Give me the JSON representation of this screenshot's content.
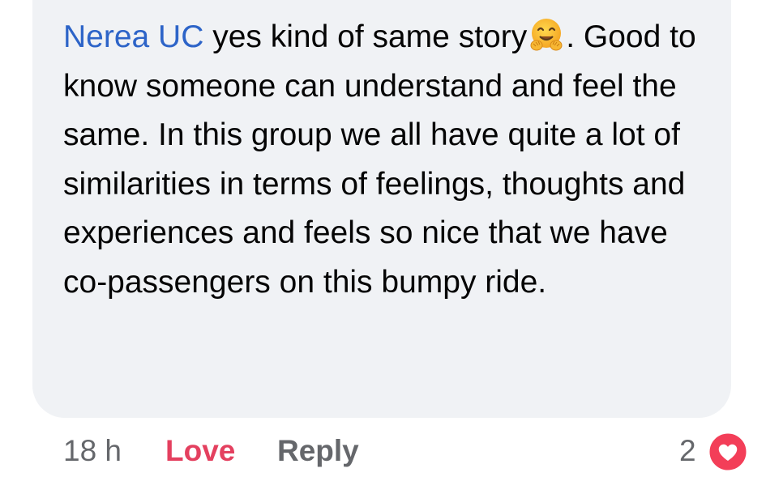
{
  "comment": {
    "author": "Nerea UC",
    "text_before_emoji": " yes kind of same story",
    "emoji": "hugging-face-icon",
    "text_after_emoji": ". Good to know someone can understand and feel the same. In this group we all have quite a lot of similarities in terms of feelings, thoughts and experiences and feels so nice that we have co-passengers on this bumpy ride."
  },
  "footer": {
    "time": "18 h",
    "love_label": "Love",
    "reply_label": "Reply",
    "reaction_count": "2",
    "reaction_icon": "heart-icon"
  },
  "colors": {
    "bubble_bg": "#f0f2f5",
    "author": "#2d64c8",
    "love": "#e4405f",
    "muted": "#65676b",
    "text": "#050505"
  }
}
